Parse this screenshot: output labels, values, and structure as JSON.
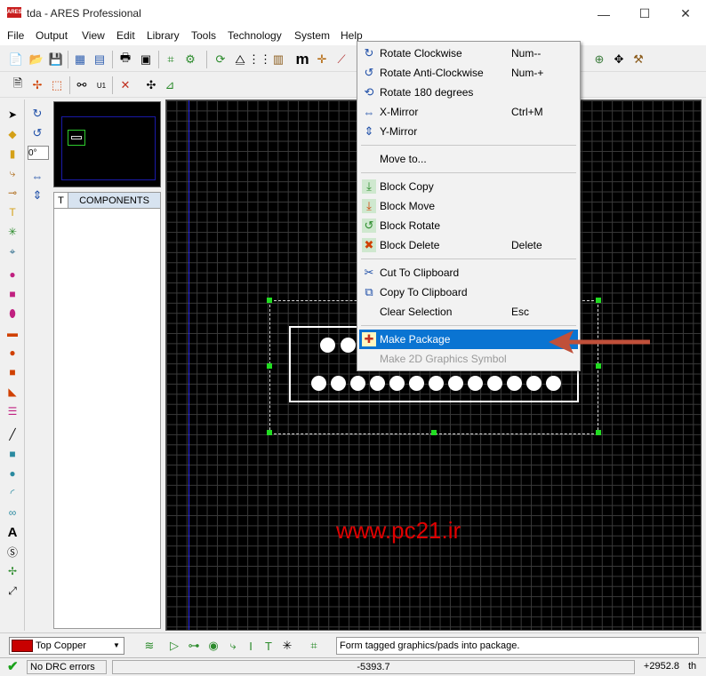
{
  "window": {
    "title": "tda - ARES Professional",
    "app_icon_text": "ARES",
    "minimize": "—",
    "maximize": "☐",
    "close": "✕"
  },
  "menu": {
    "file": "File",
    "output": "Output",
    "view": "View",
    "edit": "Edit",
    "library": "Library",
    "tools": "Tools",
    "technology": "Technology",
    "system": "System",
    "help": "Help"
  },
  "toolbar": {
    "m_label": "m",
    "plus_label": "✛"
  },
  "rotation": {
    "angle_value": "0°"
  },
  "components_panel": {
    "tab_label": "T",
    "header": "COMPONENTS"
  },
  "context_menu": {
    "items": [
      {
        "label": "Rotate Clockwise",
        "shortcut": "Num--",
        "icon": "rotate-cw-icon"
      },
      {
        "label": "Rotate Anti-Clockwise",
        "shortcut": "Num-+",
        "icon": "rotate-ccw-icon"
      },
      {
        "label": "Rotate 180 degrees",
        "shortcut": "",
        "icon": "rotate-180-icon"
      },
      {
        "label": "X-Mirror",
        "shortcut": "Ctrl+M",
        "icon": "x-mirror-icon"
      },
      {
        "label": "Y-Mirror",
        "shortcut": "",
        "icon": "y-mirror-icon"
      },
      {
        "label": "Move to...",
        "shortcut": "",
        "icon": ""
      },
      {
        "label": "Block Copy",
        "shortcut": "",
        "icon": "block-copy-icon"
      },
      {
        "label": "Block Move",
        "shortcut": "",
        "icon": "block-move-icon"
      },
      {
        "label": "Block Rotate",
        "shortcut": "",
        "icon": "block-rotate-icon"
      },
      {
        "label": "Block Delete",
        "shortcut": "Delete",
        "icon": "block-delete-icon"
      },
      {
        "label": "Cut To Clipboard",
        "shortcut": "",
        "icon": "scissors-icon"
      },
      {
        "label": "Copy To Clipboard",
        "shortcut": "",
        "icon": "copy-icon"
      },
      {
        "label": "Clear Selection",
        "shortcut": "Esc",
        "icon": ""
      },
      {
        "label": "Make Package",
        "shortcut": "",
        "icon": "make-package-icon",
        "highlighted": true
      },
      {
        "label": "Make 2D Graphics Symbol",
        "shortcut": "",
        "icon": "",
        "disabled": true
      }
    ]
  },
  "canvas": {
    "watermark": "www.pc21.ir"
  },
  "bottom": {
    "layer_name": "Top Copper",
    "layer_color": "#c80000",
    "hint": "Form tagged graphics/pads into package."
  },
  "status": {
    "drc": "No DRC errors",
    "x": "-5393.7",
    "y": "+2952.8",
    "unit": "th"
  },
  "colors": {
    "accent": "#0a74d2",
    "grid_background": "#000000",
    "selection_handle": "#22dd22",
    "arrow": "#c0503a"
  }
}
